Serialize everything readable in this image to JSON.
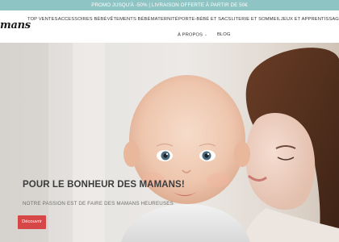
{
  "promo_bar": {
    "text": "PROMO JUSQU'À -50% | LIVRAISON OFFERTE À PARTIR DE 50€"
  },
  "header": {
    "logo_text": "mans",
    "nav": [
      {
        "label": "TOP VENTES"
      },
      {
        "label": "ACCESSOIRES BÉBÉ"
      },
      {
        "label": "VÊTEMENTS BÉBÉ"
      },
      {
        "label": "MATERNITÉ"
      },
      {
        "label": "PORTE-BÉBÉ ET SACS"
      },
      {
        "label": "LITERIE ET SOMMEIL"
      },
      {
        "label": "JEUX ET APPRENTISSAG"
      }
    ],
    "nav_row2": [
      {
        "label": "À PROPOS",
        "icon": "chevron-down-icon"
      },
      {
        "label": "BLOG"
      }
    ]
  },
  "hero": {
    "title": "POUR LE BONHEUR DES MAMANS!",
    "subtitle": "NOTRE PASSION EST DE FAIRE DES MAMANS HEUREUSES",
    "button_label": "Découvrir",
    "button_color": "#d64848"
  },
  "colors": {
    "promo_bar_bg": "#8fc4c4",
    "text_dark": "#333333"
  }
}
